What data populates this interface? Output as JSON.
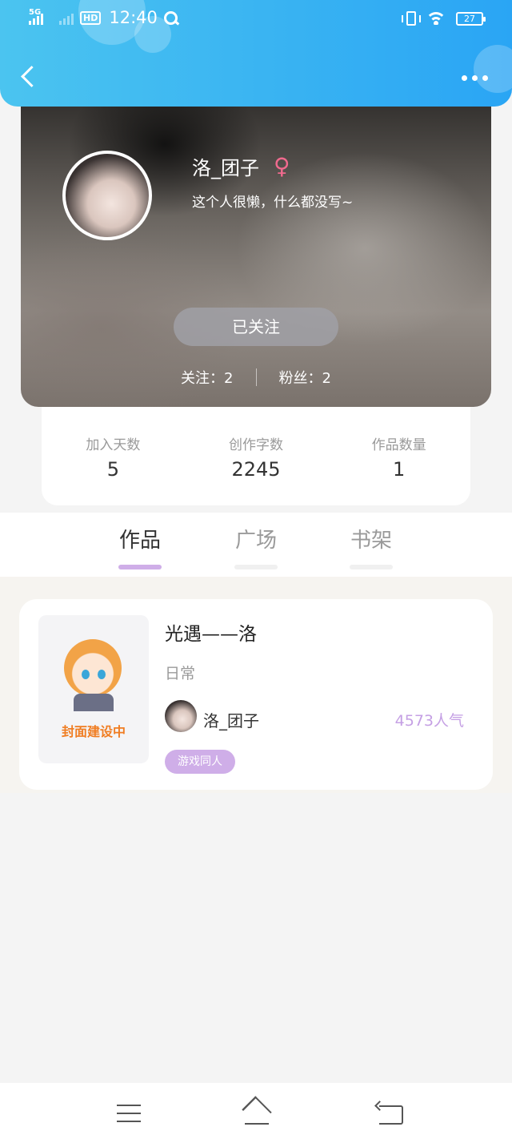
{
  "status_bar": {
    "network": "5G",
    "hd": "HD",
    "time": "12:40",
    "battery": "27"
  },
  "profile": {
    "username": "洛_团子",
    "gender_symbol": "♀",
    "bio": "这个人很懒，什么都没写~",
    "follow_button": "已关注",
    "following": "关注：2",
    "fans": "粉丝：2"
  },
  "stats": [
    {
      "label": "加入天数",
      "value": "5"
    },
    {
      "label": "创作字数",
      "value": "2245"
    },
    {
      "label": "作品数量",
      "value": "1"
    }
  ],
  "tabs": [
    {
      "label": "作品",
      "active": true
    },
    {
      "label": "广场",
      "active": false
    },
    {
      "label": "书架",
      "active": false
    }
  ],
  "works": [
    {
      "cover_text": "封面建设中",
      "title": "光遇——洛",
      "category": "日常",
      "author": "洛_团子",
      "popularity": "4573人气",
      "tag": "游戏同人"
    }
  ],
  "colors": {
    "header": "#2aa5f4",
    "accent": "#cfaee8",
    "gender": "#f06a8e"
  },
  "icons": {
    "back": "chevron-left-icon",
    "more": "more-dots-icon",
    "nav": [
      "menu-icon",
      "home-icon",
      "return-icon"
    ]
  }
}
